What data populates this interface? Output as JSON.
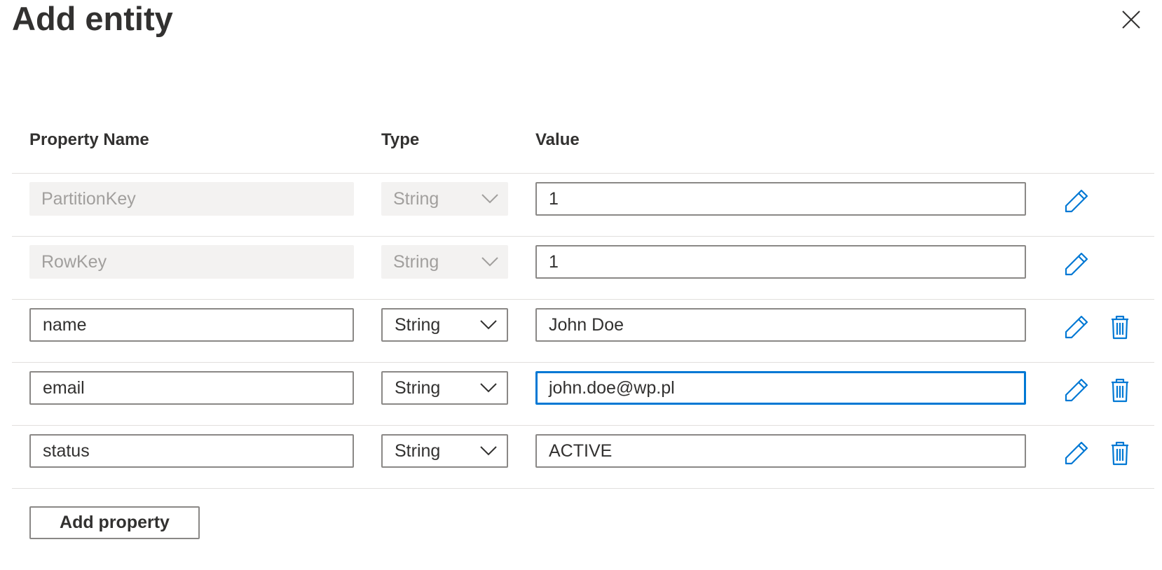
{
  "dialog": {
    "title": "Add entity",
    "close_icon": "close-icon"
  },
  "table": {
    "headers": {
      "property_name": "Property Name",
      "type": "Type",
      "value": "Value"
    },
    "rows": [
      {
        "name": "PartitionKey",
        "type": "String",
        "value": "1",
        "editable": false,
        "deletable": false
      },
      {
        "name": "RowKey",
        "type": "String",
        "value": "1",
        "editable": false,
        "deletable": false
      },
      {
        "name": "name",
        "type": "String",
        "value": "John Doe",
        "editable": true,
        "deletable": true
      },
      {
        "name": "email",
        "type": "String",
        "value": "john.doe@wp.pl",
        "editable": true,
        "deletable": true,
        "focused": true
      },
      {
        "name": "status",
        "type": "String",
        "value": "ACTIVE",
        "editable": true,
        "deletable": true
      }
    ]
  },
  "actions": {
    "add_property_label": "Add property"
  },
  "icons": {
    "edit": "pencil-icon",
    "delete": "trash-icon",
    "dropdown": "chevron-down-icon"
  },
  "colors": {
    "accent": "#0078d4",
    "text": "#323130",
    "disabled_bg": "#f3f2f1",
    "disabled_text": "#a19f9d",
    "border": "#8a8886"
  }
}
